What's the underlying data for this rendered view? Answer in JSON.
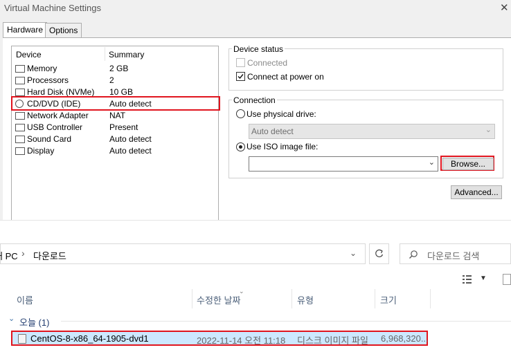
{
  "vm_dialog": {
    "title": "Virtual Machine Settings",
    "tabs": [
      "Hardware",
      "Options"
    ],
    "device_list": {
      "header_device": "Device",
      "header_summary": "Summary",
      "rows": [
        {
          "name": "Memory",
          "summary": "2 GB",
          "icon": "memory-icon"
        },
        {
          "name": "Processors",
          "summary": "2",
          "icon": "processor-icon"
        },
        {
          "name": "Hard Disk (NVMe)",
          "summary": "10 GB",
          "icon": "hard-disk-icon"
        },
        {
          "name": "CD/DVD (IDE)",
          "summary": "Auto detect",
          "icon": "cd-dvd-icon",
          "selected": true
        },
        {
          "name": "Network Adapter",
          "summary": "NAT",
          "icon": "network-adapter-icon"
        },
        {
          "name": "USB Controller",
          "summary": "Present",
          "icon": "usb-icon"
        },
        {
          "name": "Sound Card",
          "summary": "Auto detect",
          "icon": "sound-card-icon"
        },
        {
          "name": "Display",
          "summary": "Auto detect",
          "icon": "display-icon"
        }
      ]
    },
    "device_status": {
      "label": "Device status",
      "connected_label": "Connected",
      "connected_checked": false,
      "connect_at_power_on_label": "Connect at power on",
      "connect_at_power_on_checked": true
    },
    "connection": {
      "label": "Connection",
      "physical_drive_label": "Use physical drive:",
      "physical_drive_value": "Auto detect",
      "iso_label": "Use ISO image file:",
      "iso_value": "",
      "selected": "iso",
      "browse_label": "Browse...",
      "advanced_label": "Advanced..."
    }
  },
  "explorer": {
    "breadcrumb_root": "내 PC",
    "breadcrumb_sep": "›",
    "breadcrumb_current": "다운로드",
    "search_placeholder": "다운로드 검색",
    "columns": [
      "이름",
      "수정한 날짜",
      "유형",
      "크기"
    ],
    "group_label": "오늘 (1)",
    "files": [
      {
        "name": "CentOS-8-x86_64-1905-dvd1",
        "modified": "2022-11-14 오전 11:18",
        "type": "디스크 이미지 파일",
        "size": "6,968,320..."
      }
    ]
  },
  "colors": {
    "highlight_red": "#e0141e",
    "selection_blue": "#cce8ff",
    "header_text": "#4c607a"
  }
}
